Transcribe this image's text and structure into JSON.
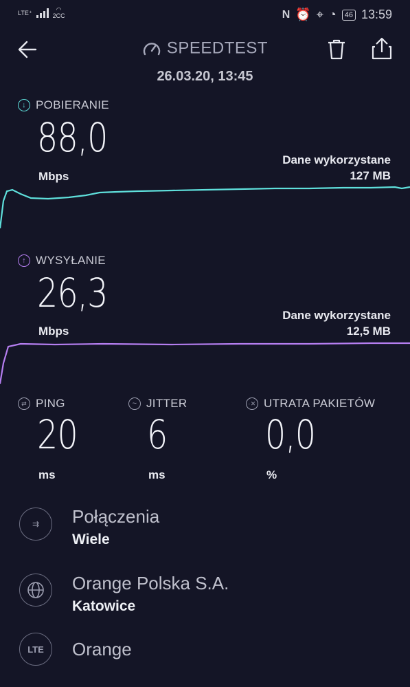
{
  "status_bar": {
    "network": "LTE⁺",
    "network_sub": "2CC",
    "battery": "46",
    "time": "13:59"
  },
  "header": {
    "title": "SPEEDTEST",
    "date": "26.03.20, 13:45"
  },
  "download": {
    "label": "POBIERANIE",
    "value": "88,0",
    "unit": "Mbps",
    "data_used_label": "Dane wykorzystane",
    "data_used_value": "127 MB",
    "color": "#5fe0dc"
  },
  "upload": {
    "label": "WYSYŁANIE",
    "value": "26,3",
    "unit": "Mbps",
    "data_used_label": "Dane wykorzystane",
    "data_used_value": "12,5 MB",
    "color": "#b57ef0"
  },
  "metrics": [
    {
      "label": "PING",
      "value": "20",
      "unit": "ms",
      "icon": "ping-icon"
    },
    {
      "label": "JITTER",
      "value": "6",
      "unit": "ms",
      "icon": "jitter-icon"
    },
    {
      "label": "UTRATA PAKIETÓW",
      "value": "0,0",
      "unit": "%",
      "icon": "packet-loss-icon"
    }
  ],
  "info": [
    {
      "title": "Połączenia",
      "subtitle": "Wiele",
      "icon": "connections-icon"
    },
    {
      "title": "Orange Polska S.A.",
      "subtitle": "Katowice",
      "icon": "globe-icon"
    },
    {
      "title": "Orange",
      "subtitle": "",
      "icon": "lte-icon",
      "icon_text": "LTE"
    }
  ]
}
